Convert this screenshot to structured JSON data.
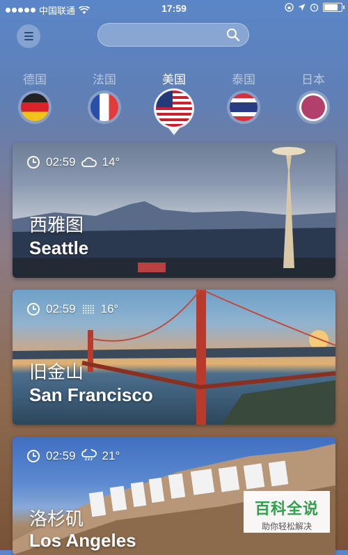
{
  "status_bar": {
    "carrier": "中国联通",
    "time": "17:59",
    "battery_level": 0.85
  },
  "search": {
    "placeholder": ""
  },
  "countries": [
    {
      "label": "德国",
      "flag": "germany-flag-icon",
      "active": false
    },
    {
      "label": "法国",
      "flag": "france-flag-icon",
      "active": false
    },
    {
      "label": "美国",
      "flag": "usa-flag-icon",
      "active": true
    },
    {
      "label": "泰国",
      "flag": "thailand-flag-icon",
      "active": false
    },
    {
      "label": "日本",
      "flag": "japan-flag-icon",
      "active": false
    }
  ],
  "cities": [
    {
      "name_cn": "西雅图",
      "name_en": "Seattle",
      "time": "02:59",
      "temp": "14°",
      "weather_icon": "cloud-icon"
    },
    {
      "name_cn": "旧金山",
      "name_en": "San Francisco",
      "time": "02:59",
      "temp": "16°",
      "weather_icon": "fog-icon"
    },
    {
      "name_cn": "洛杉矶",
      "name_en": "Los Angeles",
      "time": "02:59",
      "temp": "21°",
      "weather_icon": "rain-cloud-icon"
    }
  ],
  "watermark": {
    "main": "百科全说",
    "sub": "助你轻松解决"
  },
  "colors": {
    "accent": "#2ea04a",
    "menu_icon": "#2c4a78"
  }
}
